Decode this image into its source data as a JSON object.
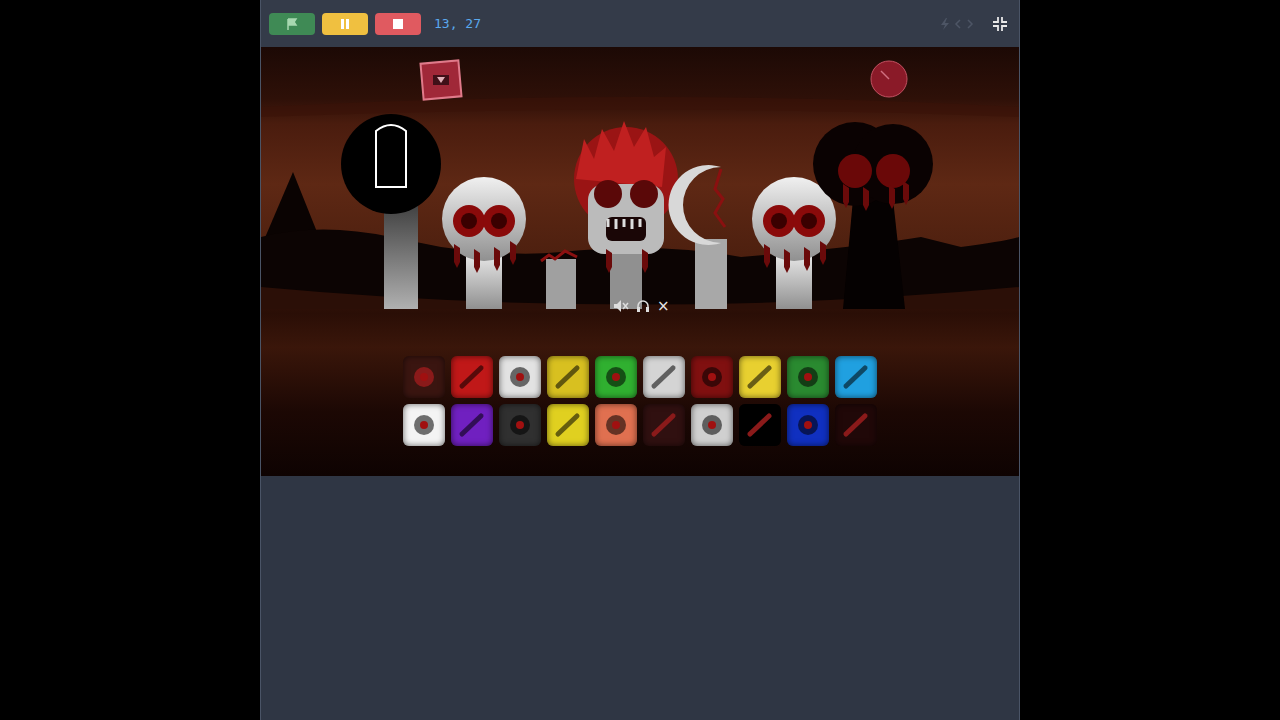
{
  "toolbar": {
    "coordinates": "13, 27"
  },
  "character_controls": {
    "close": "×"
  },
  "characters": [
    {
      "kind": "tall"
    },
    {
      "kind": "skull"
    },
    {
      "kind": "stump"
    },
    {
      "kind": "horror"
    },
    {
      "kind": "moon"
    },
    {
      "kind": "skull"
    },
    {
      "kind": "dark"
    }
  ],
  "icons": [
    [
      {
        "color": "#3a1510"
      },
      {
        "color": "#c01818"
      },
      {
        "color": "#e2e2e2"
      },
      {
        "color": "#d8c020"
      },
      {
        "color": "#30b030"
      },
      {
        "color": "#d4d4d4"
      },
      {
        "color": "#801010"
      },
      {
        "color": "#e8d030"
      },
      {
        "color": "#2a8a30"
      },
      {
        "color": "#20a0e0"
      }
    ],
    [
      {
        "color": "#f4f4f4"
      },
      {
        "color": "#7020c0"
      },
      {
        "color": "#303030"
      },
      {
        "color": "#e0d020"
      },
      {
        "color": "#e07050"
      },
      {
        "color": "#301010"
      },
      {
        "color": "#d0d0d0"
      },
      {
        "color": "#000000"
      },
      {
        "color": "#1030c0"
      },
      {
        "color": "#200808"
      }
    ]
  ]
}
